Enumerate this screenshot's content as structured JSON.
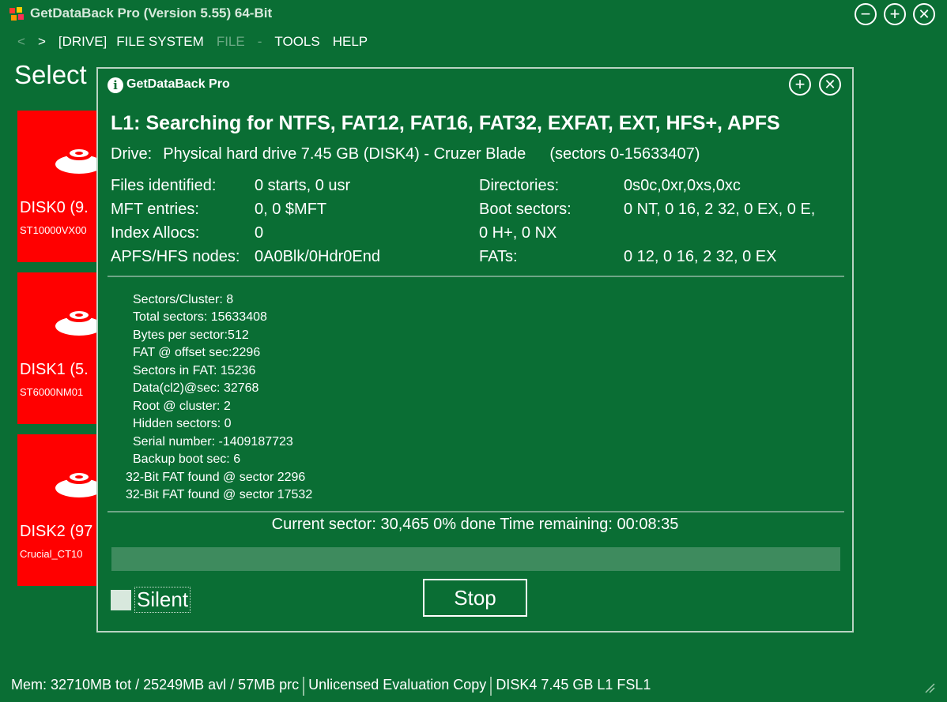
{
  "app": {
    "title": "GetDataBack Pro (Version 5.55) 64-Bit",
    "window_buttons": {
      "minimize": "−",
      "maximize": "+",
      "close": "✕"
    }
  },
  "menu": {
    "back": "<",
    "forward": ">",
    "drive": "[DRIVE]",
    "file_system": "FILE SYSTEM",
    "file": "FILE",
    "separator": "-",
    "tools": "TOOLS",
    "help": "HELP"
  },
  "page": {
    "heading": "Select"
  },
  "disks": [
    {
      "name": "DISK0 (9.",
      "model": "ST10000VX00"
    },
    {
      "name": "DISK1 (5.",
      "model": "ST6000NM01"
    },
    {
      "name": "DISK2 (97",
      "model": "Crucial_CT10"
    }
  ],
  "dialog": {
    "title": "GetDataBack Pro",
    "headline": "L1: Searching for NTFS, FAT12, FAT16, FAT32, EXFAT, EXT, HFS+, APFS",
    "drive_label": "Drive:",
    "drive_value": "Physical hard drive 7.45 GB (DISK4) - Cruzer Blade",
    "drive_sectors": "(sectors 0-15633407)",
    "stats_left": [
      {
        "label": "Files identified:",
        "value": "0 starts, 0 usr"
      },
      {
        "label": "MFT entries:",
        "value": "0, 0 $MFT"
      },
      {
        "label": "Index Allocs:",
        "value": "0"
      },
      {
        "label": "APFS/HFS nodes:",
        "value": "0A0Blk/0Hdr0End"
      }
    ],
    "stats_right": [
      {
        "label": "Directories:",
        "value": "0s0c,0xr,0xs,0xc"
      },
      {
        "label": "Boot sectors:",
        "value": "0 NT, 0 16, 2 32, 0 EX, 0 E,"
      },
      {
        "label": "",
        "value": "0 H+, 0 NX"
      },
      {
        "label": "FATs:",
        "value": "0 12, 0 16, 2 32, 0 EX"
      }
    ],
    "bpb_lines": [
      "Sectors/Cluster: 8",
      "Total sectors:  15633408",
      "Bytes per sector:512",
      "FAT @ offset sec:2296",
      "Sectors in FAT:  15236",
      "Data(cl2)@sec:   32768",
      "Root @ cluster:  2",
      "Hidden sectors:  0",
      "Serial number:   -1409187723",
      "Backup boot sec: 6"
    ],
    "found_lines": [
      "32-Bit FAT found @ sector 2296",
      "32-Bit FAT found @ sector 17532"
    ],
    "status": "Current sector: 30,465   0% done   Time remaining: 00:08:35",
    "progress_fraction": 0.0,
    "silent_label": "Silent",
    "stop_label": "Stop",
    "buttons": {
      "maximize": "+",
      "close": "✕"
    }
  },
  "statusbar": {
    "memory": "Mem: 32710MB tot / 25249MB avl / 57MB prc",
    "license": "Unlicensed Evaluation Copy",
    "drive": "DISK4 7.45 GB L1 FSL1"
  },
  "colors": {
    "background": "#0a6e34",
    "disk_tile": "#ff0000",
    "progress_track": "#3e8b5e",
    "dialog_border": "#b9d3c2"
  },
  "icons": [
    "app-logo-icon",
    "disk-icon",
    "info-icon",
    "maximize-icon",
    "close-icon",
    "minimize-icon",
    "resize-grip-icon"
  ]
}
